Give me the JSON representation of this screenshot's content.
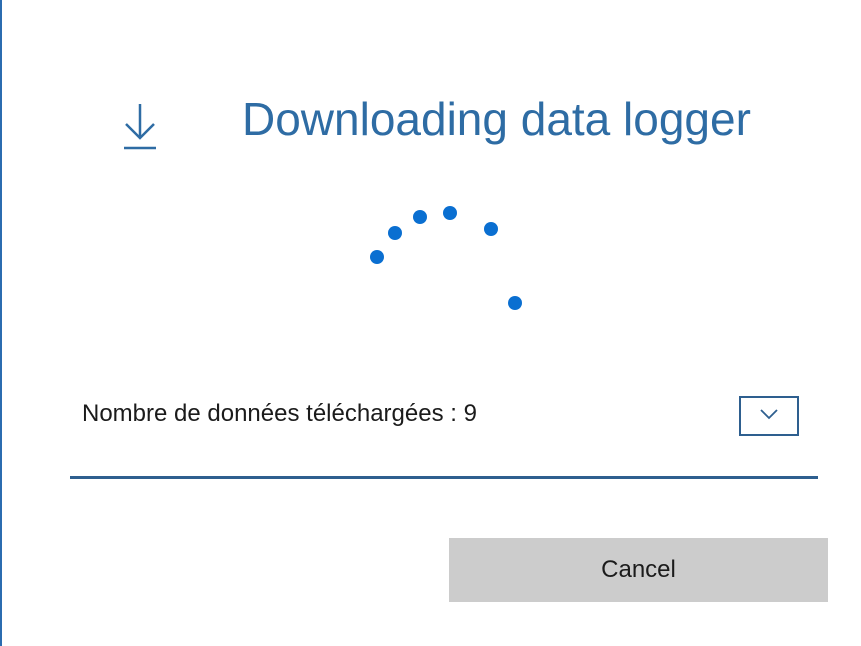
{
  "dialog": {
    "title": "Downloading data logger",
    "title_icon": "download-arrow-icon",
    "spinner_icon": "progress-ring-dots",
    "accent_color": "#2e6ca4",
    "spinner_color": "#0a6fd1",
    "status": {
      "count_label": "Nombre de données téléchargées : 9"
    },
    "expand_icon": "chevron-down-icon",
    "cancel_label": "Cancel"
  }
}
